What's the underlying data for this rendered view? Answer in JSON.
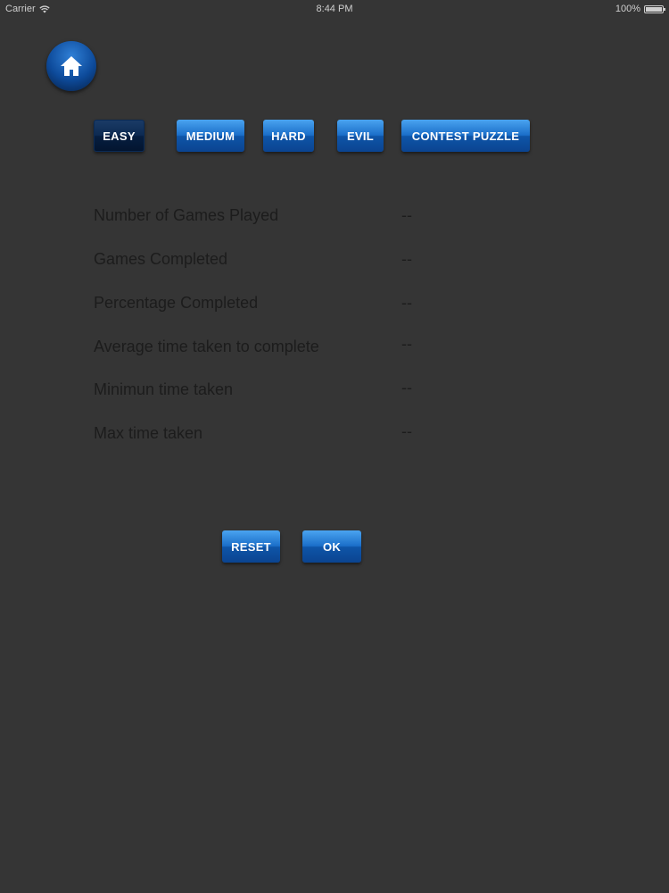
{
  "status_bar": {
    "carrier": "Carrier",
    "time": "8:44 PM",
    "battery": "100%"
  },
  "levels": [
    {
      "label": "EASY",
      "selected": true
    },
    {
      "label": "MEDIUM",
      "selected": false
    },
    {
      "label": "HARD",
      "selected": false
    },
    {
      "label": "EVIL",
      "selected": false
    },
    {
      "label": "CONTEST PUZZLE",
      "selected": false
    }
  ],
  "stats": [
    {
      "label": "Number of Games Played",
      "value": "--"
    },
    {
      "label": "Games Completed",
      "value": "--"
    },
    {
      "label": "Percentage Completed",
      "value": "--"
    },
    {
      "label": "Average time taken to complete",
      "value": "--"
    },
    {
      "label": "Minimun time taken",
      "value": "--"
    },
    {
      "label": "Max time taken",
      "value": "--"
    }
  ],
  "actions": {
    "reset_label": "RESET",
    "ok_label": "OK"
  },
  "colors": {
    "background": "#353535",
    "button_blue": "#1b6fc9",
    "selected_button": "#0d2a52",
    "text": "#1c1c1c"
  }
}
